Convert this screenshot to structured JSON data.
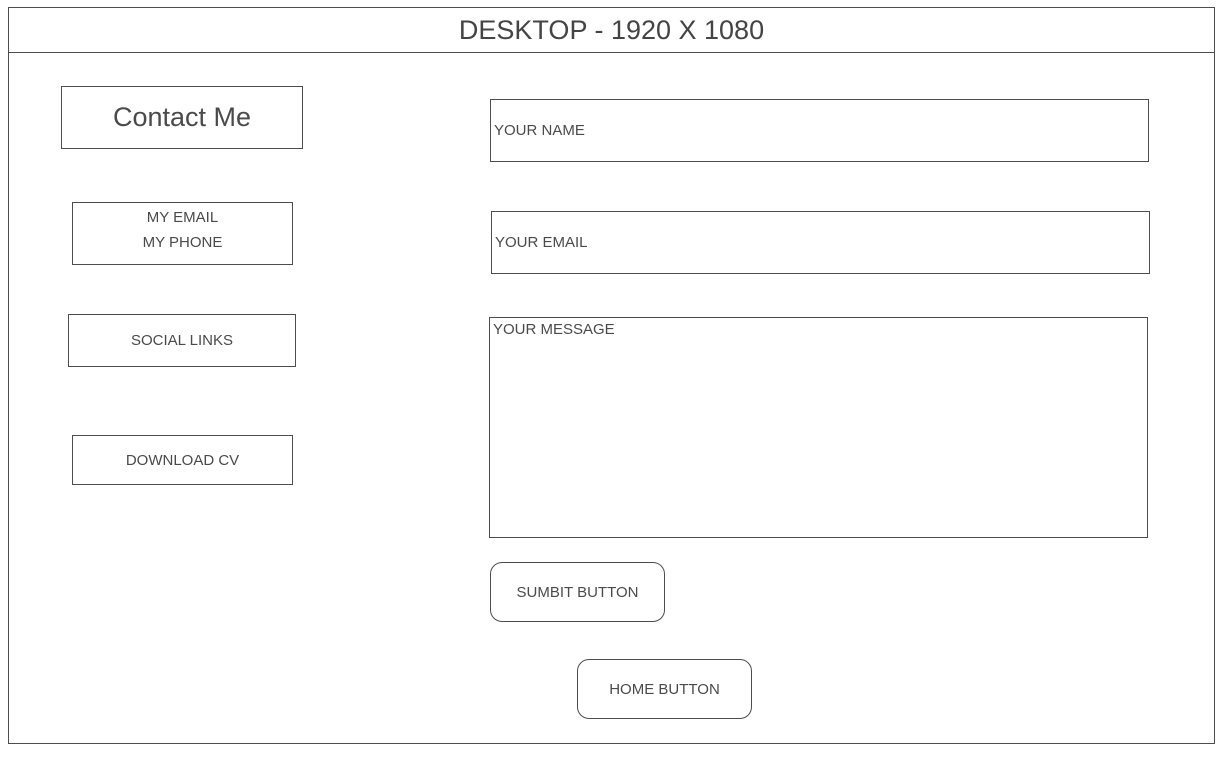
{
  "header": {
    "title": "DESKTOP - 1920 X 1080"
  },
  "sidebar": {
    "heading": "Contact Me",
    "email_label": "MY EMAIL",
    "phone_label": "MY PHONE",
    "social_links_label": "SOCIAL LINKS",
    "download_cv_label": "DOWNLOAD CV"
  },
  "form": {
    "name_placeholder": "YOUR NAME",
    "email_placeholder": "YOUR EMAIL",
    "message_placeholder": "YOUR MESSAGE",
    "submit_label": "SUMBIT BUTTON"
  },
  "footer": {
    "home_label": "HOME BUTTON"
  }
}
